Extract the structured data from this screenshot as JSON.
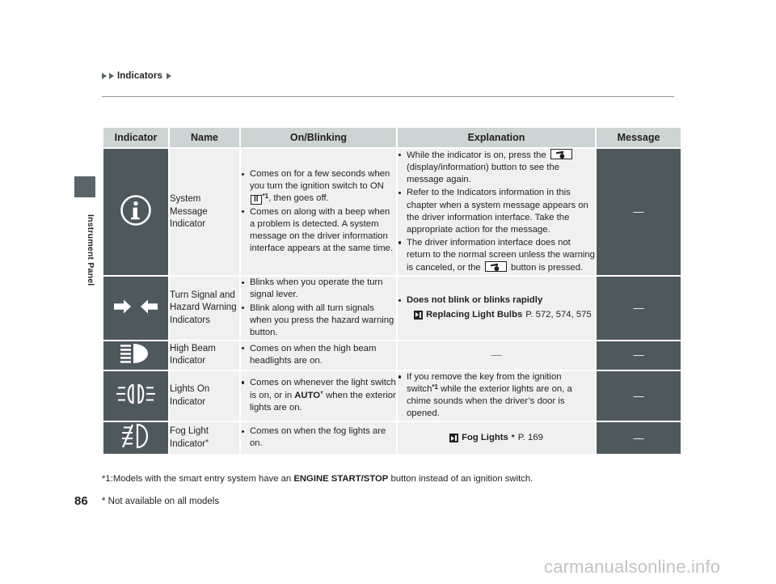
{
  "breadcrumb": {
    "text": "Indicators"
  },
  "side_tab": {
    "label": "Instrument Panel"
  },
  "table": {
    "headers": [
      "Indicator",
      "Name",
      "On/Blinking",
      "Explanation",
      "Message"
    ],
    "rows": [
      {
        "icon": "info-circle-icon",
        "name": "System Message Indicator",
        "on_blinking": [
          "Comes on for a few seconds when you turn the ignition switch to ON  , then goes off.",
          "Comes on along with a beep when a problem is detected. A system message on the driver information interface appears at the same time."
        ],
        "on_blinking_parts": {
          "b1_pre": "Comes on for a few seconds when you turn the ignition switch to ON ",
          "b1_glyph": "II",
          "b1_sup": "*1",
          "b1_post": ", then goes off.",
          "b2": "Comes on along with a beep when a problem is detected. A system message on the driver information interface appears at the same time."
        },
        "explanation_parts": {
          "e1_pre": "While the indicator is on, press the ",
          "e1_post": "(display/information) button to see the message again.",
          "e2": "Refer to the Indicators information in this chapter when a system message appears on the driver information interface. Take the appropriate action for the message.",
          "e3_pre": "The driver information interface does not return to the normal screen unless the warning is canceled, or the ",
          "e3_post": " button is pressed."
        },
        "message": "—"
      },
      {
        "icon": "turn-signal-arrows-icon",
        "name": "Turn Signal and Hazard Warning Indicators",
        "on_blinking_parts": {
          "b1": "Blinks when you operate the turn signal lever.",
          "b2": "Blink along with all turn signals when you press the hazard warning button."
        },
        "explanation_parts": {
          "heading": "Does not blink or blinks rapidly",
          "ref_title": "Replacing Light Bulbs",
          "ref_page": "P. 572, 574, 575"
        },
        "message": "—"
      },
      {
        "icon": "high-beam-icon",
        "name": "High Beam Indicator",
        "on_blinking_parts": {
          "b1": "Comes on when the high beam headlights are on."
        },
        "explanation_dash": "—",
        "message": "—"
      },
      {
        "icon": "lights-on-icon",
        "name": "Lights On Indicator",
        "on_blinking_parts": {
          "b1_pre": "Comes on whenever the light switch is on, or in ",
          "b1_bold": "AUTO",
          "b1_star": "*",
          "b1_post": " when the exterior lights are on."
        },
        "explanation_parts": {
          "e1_pre": "If you remove the key from the ignition switch",
          "e1_sup": "*1",
          "e1_post": " while the exterior lights are on, a chime sounds when the driver’s door is opened."
        },
        "message": "—"
      },
      {
        "icon": "fog-light-icon",
        "name_pre": "Fog Light Indicator",
        "name_star": "*",
        "on_blinking_parts": {
          "b1": "Comes on when the fog lights are on."
        },
        "explanation_parts": {
          "ref_title": "Fog Lights",
          "ref_star": "*",
          "ref_page": "P. 169"
        },
        "message": "—"
      }
    ]
  },
  "footnotes": {
    "fn1_pre": "*1:Models with the smart entry system have an ",
    "fn1_bold": "ENGINE START/STOP",
    "fn1_post": " button instead of an ignition switch.",
    "fn2": "* Not available on all models"
  },
  "page_number": "86",
  "watermark": "carmanualsonline.info",
  "colors": {
    "dark_cell": "#4e595d",
    "header_cell": "#ccd5d4",
    "light_cell": "#f0f0f0",
    "text": "#231f20"
  }
}
